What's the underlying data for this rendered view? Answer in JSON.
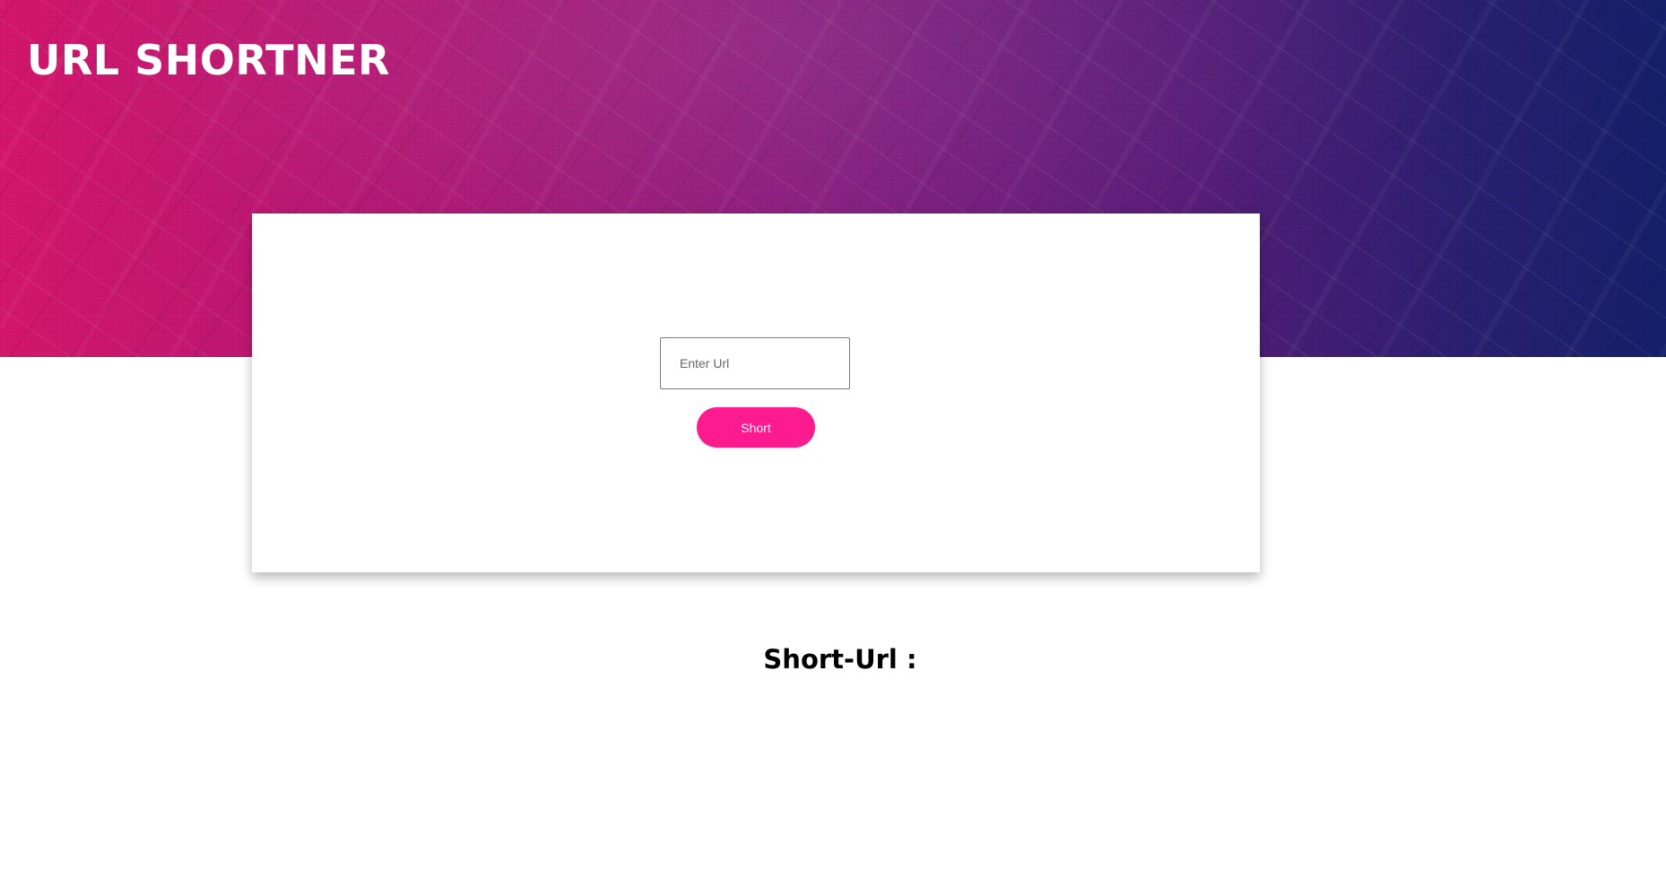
{
  "header": {
    "title": "URL SHORTNER"
  },
  "form": {
    "url_placeholder": "Enter Url",
    "url_value": "",
    "submit_label": "Short"
  },
  "result": {
    "label": "Short-Url :"
  },
  "colors": {
    "hero_gradient_start": "#d4166c",
    "hero_gradient_mid": "#861c7f",
    "hero_gradient_end": "#14206a",
    "button_accent": "#fd1b8f",
    "card_background": "#ffffff"
  }
}
